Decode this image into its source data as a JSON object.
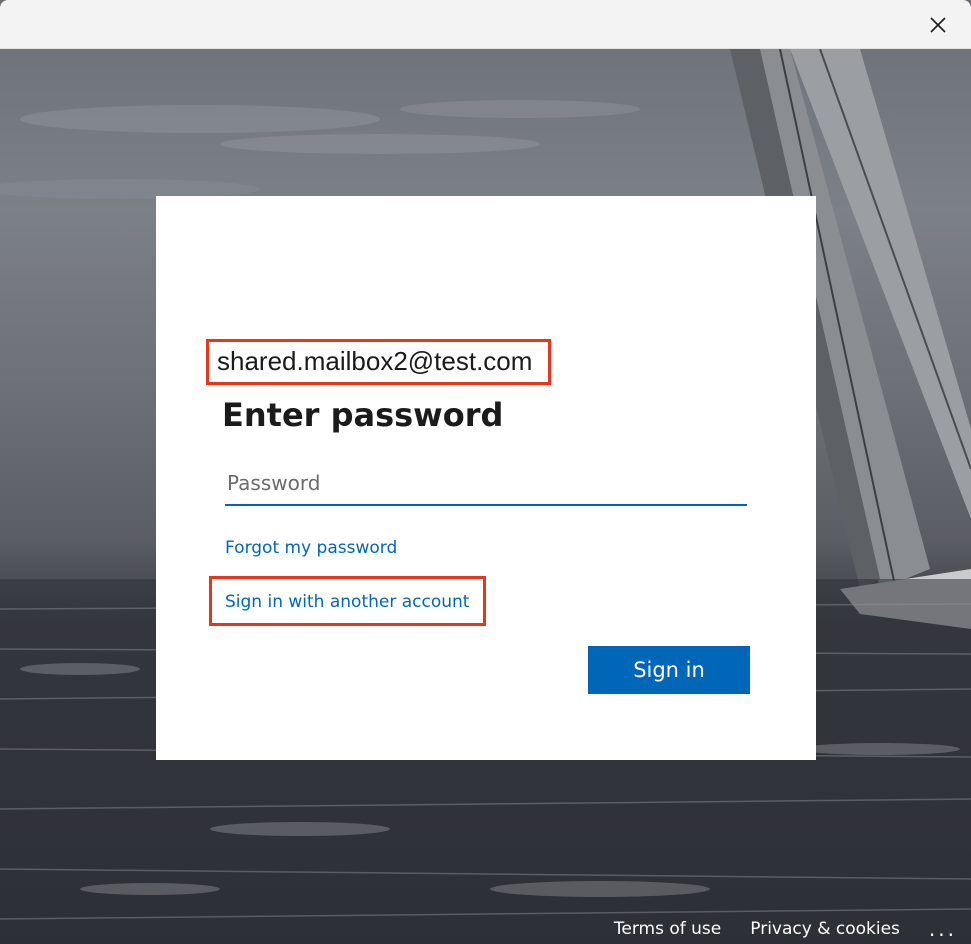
{
  "window": {
    "close_icon": "close-icon"
  },
  "signin": {
    "email": "shared.mailbox2@test.com",
    "title": "Enter password",
    "password_placeholder": "Password",
    "password_value": "",
    "forgot_label": "Forgot my password",
    "another_account_label": "Sign in with another account",
    "signin_button_label": "Sign in"
  },
  "footer": {
    "terms_label": "Terms of use",
    "privacy_label": "Privacy & cookies",
    "more_label": "..."
  },
  "colors": {
    "accent": "#0067b8",
    "highlight": "#e8361c"
  }
}
